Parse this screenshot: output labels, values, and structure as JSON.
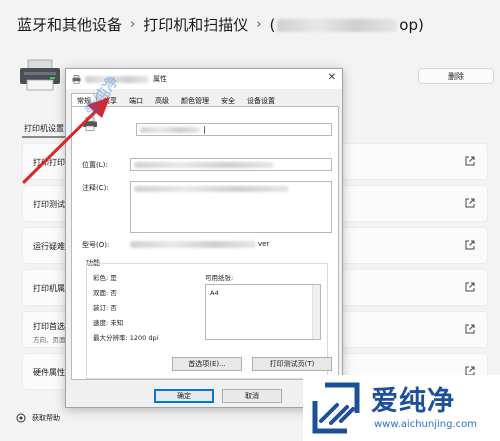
{
  "breadcrumb": {
    "item1": "蓝牙和其他设备",
    "item2": "打印机和扫描仪",
    "item3_tail": "op)"
  },
  "settings": {
    "delete_label": "删除",
    "tab_label": "打印机设置",
    "rows": [
      {
        "label": "打印打印"
      },
      {
        "label": "打印测试"
      },
      {
        "label": "运行疑难"
      },
      {
        "label": "打印机属"
      },
      {
        "label": "打印首选",
        "sub": "方向、页面"
      },
      {
        "label": "硬件属性"
      }
    ],
    "help_label": "获取帮助"
  },
  "dialog": {
    "title_suffix": "属性",
    "close_glyph": "✕",
    "tabs": [
      "常规",
      "共享",
      "端口",
      "高级",
      "颜色管理",
      "安全",
      "设备设置"
    ],
    "location_label": "位置(L):",
    "comment_label": "注释(C):",
    "model_label": "型号(O):",
    "model_tail": "ver",
    "features_label": "功能",
    "color": "彩色: 是",
    "duplex": "双面: 否",
    "staple": "装订: 否",
    "speed": "速度: 未知",
    "resolution": "最大分辨率: 1200 dpi",
    "paper_label": "可用纸张:",
    "paper_value": "A4",
    "prefs_button": "首选项(E)...",
    "test_button": "打印测试页(T)",
    "ok_button": "确定",
    "cancel_button": "取消"
  },
  "watermark": {
    "logo_text": "爱纯净",
    "url": "www.aichunjing.com",
    "diagonal": "爱纯净"
  }
}
